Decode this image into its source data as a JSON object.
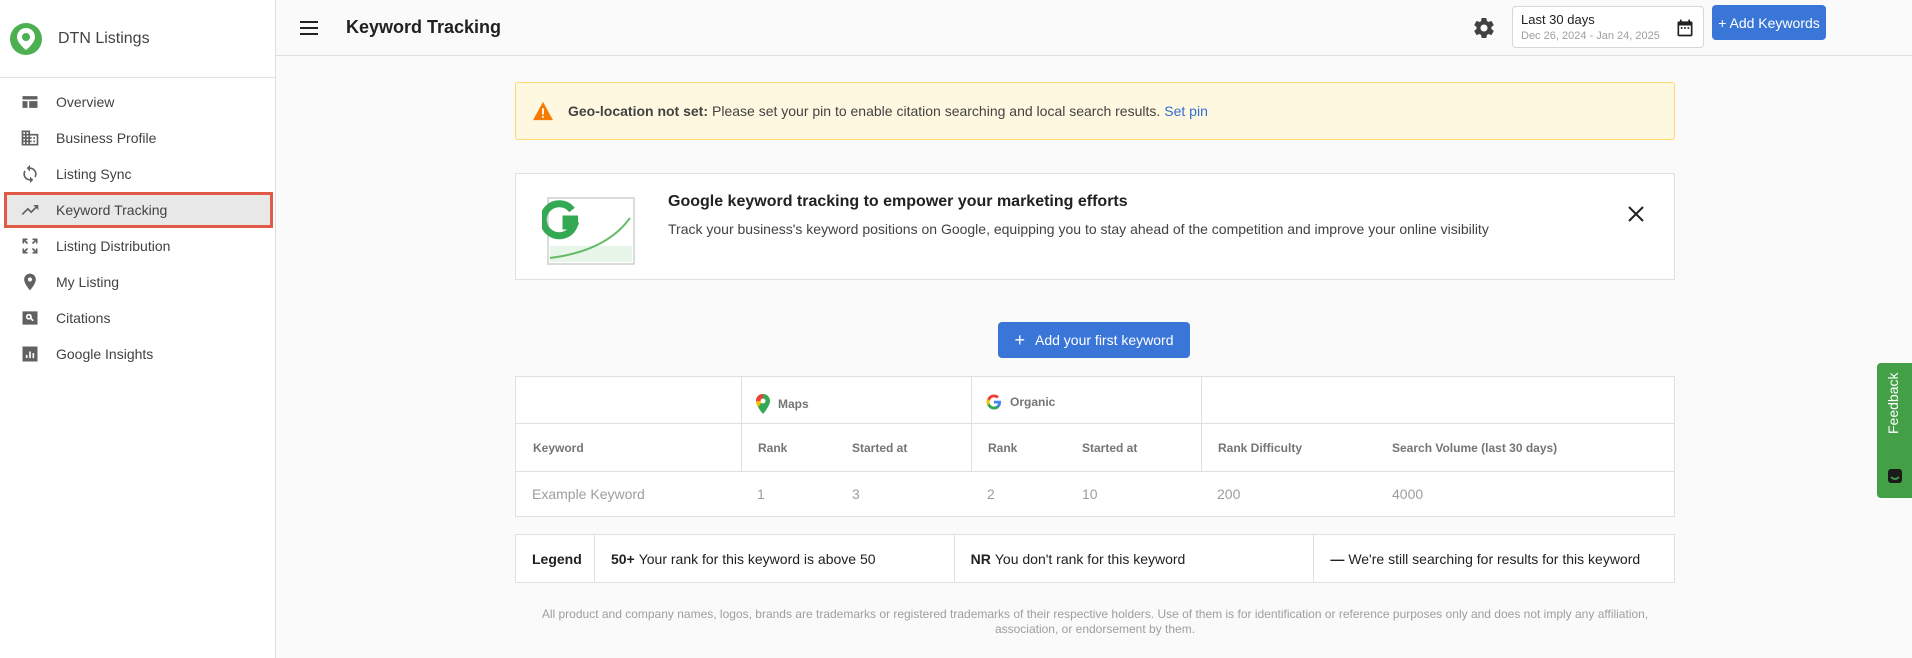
{
  "brand": {
    "name": "DTN Listings"
  },
  "sidebar": {
    "items": [
      {
        "label": "Overview",
        "icon": "overview-icon"
      },
      {
        "label": "Business Profile",
        "icon": "building-icon"
      },
      {
        "label": "Listing Sync",
        "icon": "sync-icon"
      },
      {
        "label": "Keyword Tracking",
        "icon": "trending-up-icon",
        "active": true
      },
      {
        "label": "Listing Distribution",
        "icon": "expand-icon"
      },
      {
        "label": "My Listing",
        "icon": "location-pin-icon"
      },
      {
        "label": "Citations",
        "icon": "search-box-icon"
      },
      {
        "label": "Google Insights",
        "icon": "bar-chart-icon"
      }
    ]
  },
  "header": {
    "title": "Keyword Tracking",
    "date_range": {
      "label": "Last 30 days",
      "range": "Dec 26, 2024 - Jan 24, 2025"
    },
    "add_button": "+ Add Keywords"
  },
  "alert": {
    "strong": "Geo-location not set:",
    "text": "Please set your pin to enable citation searching and local search results.",
    "link": "Set pin"
  },
  "promo": {
    "title": "Google keyword tracking to empower your marketing efforts",
    "text": "Track your business's keyword positions on Google, equipping you to stay ahead of the competition and improve your online visibility"
  },
  "first_keyword_button": "Add your first keyword",
  "table": {
    "groups": {
      "maps": "Maps",
      "organic": "Organic"
    },
    "headers": {
      "keyword": "Keyword",
      "maps_rank": "Rank",
      "maps_started": "Started at",
      "organic_rank": "Rank",
      "organic_started": "Started at",
      "difficulty": "Rank Difficulty",
      "volume": "Search Volume (last 30 days)"
    },
    "example": {
      "keyword": "Example Keyword",
      "maps_rank": "1",
      "maps_started": "3",
      "organic_rank": "2",
      "organic_started": "10",
      "difficulty": "200",
      "volume": "4000"
    }
  },
  "legend": {
    "title": "Legend",
    "items": [
      {
        "key": "50+",
        "text": "Your rank for this keyword is above 50"
      },
      {
        "key": "NR",
        "text": "You don't rank for this keyword"
      },
      {
        "key": "—",
        "text": "We're still searching for results for this keyword"
      }
    ]
  },
  "disclaimer": "All product and company names, logos, brands are trademarks or registered trademarks of their respective holders. Use of them is for identification or reference purposes only and does not imply any affiliation, association, or endorsement by them.",
  "feedback": "Feedback",
  "colors": {
    "primary": "#3a76d8",
    "brand": "#4caf50",
    "alert_bg": "#fff8e1",
    "alert_icon": "#f57c00",
    "feedback": "#43a047",
    "active_outline": "#e05a47"
  }
}
